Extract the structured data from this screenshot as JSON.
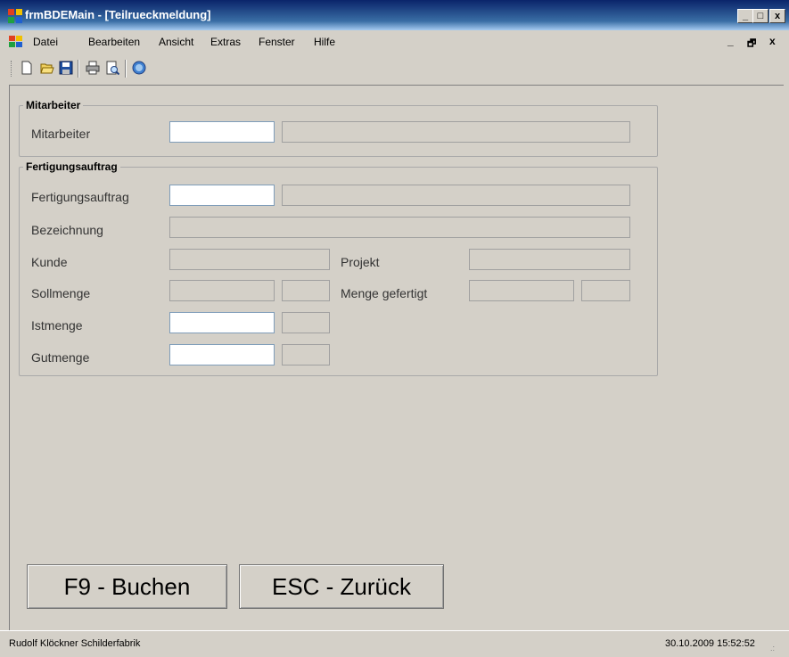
{
  "window": {
    "title": "frmBDEMain - [Teilrueckmeldung]",
    "minimize": "_",
    "maximize": "□",
    "close": "x"
  },
  "menu": {
    "items": [
      "Datei",
      "Bearbeiten",
      "Ansicht",
      "Extras",
      "Fenster",
      "Hilfe"
    ],
    "mdi_minimize": "_",
    "mdi_restore": "🗗",
    "mdi_close": "x"
  },
  "toolbar": {
    "buttons": [
      "new-icon",
      "open-icon",
      "save-icon",
      "print-icon",
      "print-preview-icon",
      "help-icon"
    ]
  },
  "mitarbeiter_group": {
    "title": "Mitarbeiter",
    "label": "Mitarbeiter",
    "code_value": "",
    "name_value": ""
  },
  "fertigung_group": {
    "title": "Fertigungsauftrag",
    "labels": {
      "fertigungsauftrag": "Fertigungsauftrag",
      "bezeichnung": "Bezeichnung",
      "kunde": "Kunde",
      "projekt": "Projekt",
      "sollmenge": "Sollmenge",
      "menge_gefertigt": "Menge gefertigt",
      "istmenge": "Istmenge",
      "gutmenge": "Gutmenge"
    }
  },
  "buttons": {
    "book": "F9 - Buchen",
    "back": "ESC - Zurück"
  },
  "status": {
    "company": "Rudolf Klöckner Schilderfabrik",
    "datetime": "30.10.2009 15:52:52"
  }
}
